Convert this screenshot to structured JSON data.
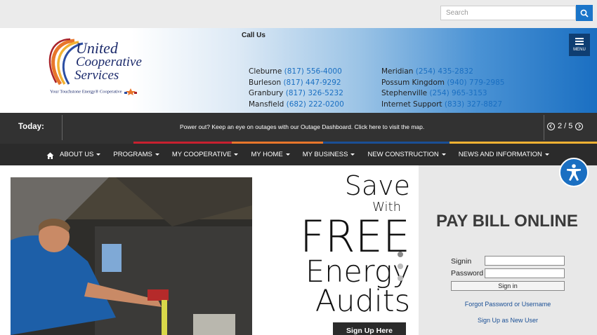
{
  "search": {
    "placeholder": "Search"
  },
  "header": {
    "call_us": "Call Us",
    "logo": {
      "line1": "United",
      "line2": "Cooperative",
      "line3": "Services",
      "tagline": "Your Touchstone Energy® Cooperative"
    },
    "phones_left": [
      {
        "city": "Cleburne",
        "number": "(817) 556-4000"
      },
      {
        "city": "Burleson",
        "number": "(817) 447-9292"
      },
      {
        "city": "Granbury",
        "number": "(817) 326-5232"
      },
      {
        "city": "Mansfield",
        "number": "(682) 222-0200"
      }
    ],
    "phones_right": [
      {
        "city": "Meridian",
        "number": "(254) 435-2832"
      },
      {
        "city": "Possum Kingdom",
        "number": "(940) 779-2985"
      },
      {
        "city": "Stephenville",
        "number": "(254) 965-3153"
      },
      {
        "city": "Internet Support ",
        "number": "(833) 327-8827"
      }
    ],
    "menu_label": "MENU"
  },
  "today": {
    "label": "Today:",
    "message": "Power out? Keep an eye on outages with our Outage Dashboard. Click here to visit the map.",
    "pager": "2 / 5"
  },
  "nav": {
    "items": [
      "ABOUT US",
      "PROGRAMS",
      "MY COOPERATIVE",
      "MY HOME",
      "MY BUSINESS",
      "NEW CONSTRUCTION",
      "NEWS AND INFORMATION"
    ]
  },
  "promo": {
    "save": "Save",
    "with": "With",
    "free": "FREE",
    "energy": "Energy",
    "audits": "Audits",
    "button": "Sign Up Here"
  },
  "paybill": {
    "title": "PAY BILL ONLINE",
    "signin_label": "Signin",
    "password_label": "Password",
    "signin_button": "Sign in",
    "forgot_link": "Forgot Password or Username",
    "signup_link": "Sign Up as New User"
  },
  "colors": {
    "accent": "#1a6fc2",
    "dark": "#2b2b2b",
    "panel": "#e8e8e8"
  }
}
